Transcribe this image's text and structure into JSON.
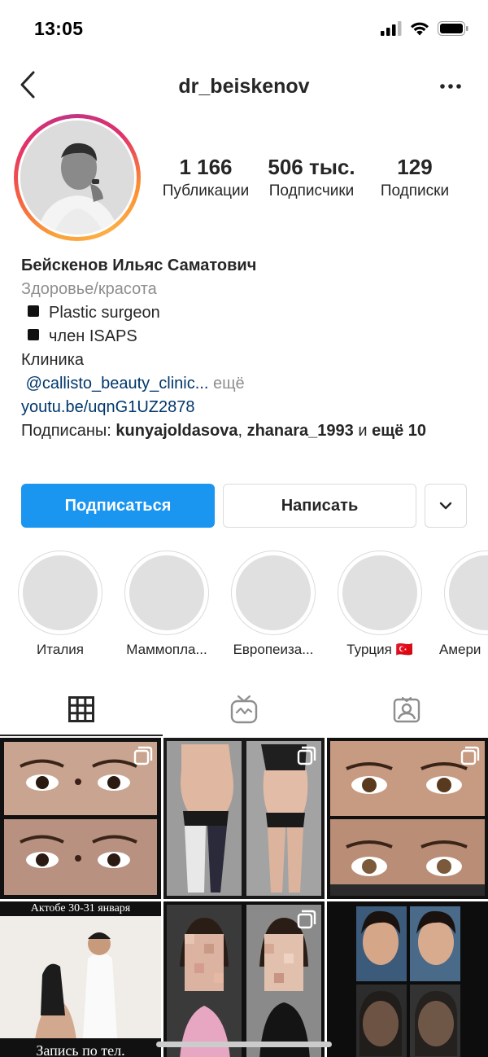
{
  "status": {
    "time": "13:05"
  },
  "nav": {
    "username": "dr_beiskenov"
  },
  "stats": {
    "posts_num": "1 166",
    "posts_label": "Публикации",
    "followers_num": "506 тыс.",
    "followers_label": "Подписчики",
    "following_num": "129",
    "following_label": "Подписки"
  },
  "bio": {
    "name": "Бейскенов Ильяс Саматович",
    "category": "Здоровье/красота",
    "line1": "Plastic surgeon",
    "line2": "член ISAPS",
    "line3": "Клиника",
    "mention": "@callisto_beauty_clinic...",
    "more": " ещё",
    "link": "youtu.be/uqnG1UZ2878",
    "followed_prefix": "Подписаны: ",
    "followed_users": "kunyajoldasova",
    "followed_sep": ", ",
    "followed_users2": "zhanara_1993",
    "followed_and": " и ",
    "followed_more": "ещё 10"
  },
  "buttons": {
    "follow": "Подписаться",
    "message": "Написать"
  },
  "highlights": [
    {
      "label": "Италия"
    },
    {
      "label": "Маммопла..."
    },
    {
      "label": "Европеиза..."
    },
    {
      "label": "Турция 🇹🇷"
    },
    {
      "label": "Амери"
    }
  ],
  "tabs": [
    {
      "icon": "grid-icon"
    },
    {
      "icon": "igtv-icon"
    },
    {
      "icon": "tagged-icon"
    }
  ],
  "posts": [
    {
      "caption_top": "",
      "caption_bottom": ""
    },
    {
      "caption_top": "",
      "caption_bottom": ""
    },
    {
      "caption_top": "",
      "caption_bottom": ""
    },
    {
      "caption_top": "Актобе 30-31 января",
      "caption_bottom": "Запись по тел."
    },
    {
      "caption_top": "",
      "caption_bottom": ""
    },
    {
      "caption_top": "",
      "caption_bottom": ""
    }
  ],
  "colors": {
    "accent": "#1a95f0",
    "link": "#00376b",
    "muted": "#8e8e8e"
  }
}
